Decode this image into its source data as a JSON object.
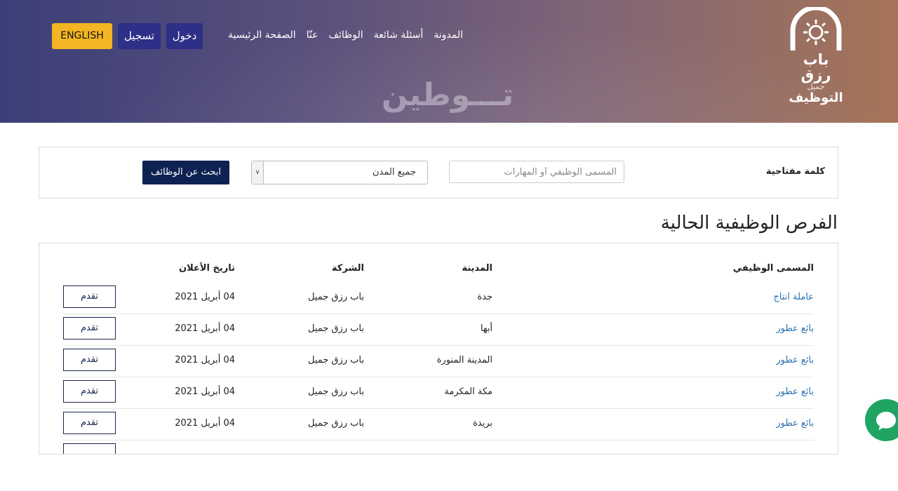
{
  "header": {
    "logo": {
      "line1": "باب رزق",
      "line2": "جميل",
      "line3": "التوظيف"
    },
    "nav": [
      "الصفحة الرئيسية",
      "عنّا",
      "الوظائف",
      "أسئلة شائعة",
      "المدونة"
    ],
    "login_label": "دخول",
    "register_label": "تسجيل",
    "english_label": "ENGLISH",
    "watermark": "تـــوطين",
    "colors": {
      "gradient_start": "#3c3f78",
      "gradient_end": "#a67458",
      "english_btn": "#f4b524",
      "auth_btn": "#2e2f86"
    }
  },
  "search": {
    "keyword_label": "كلمة مفتاحية",
    "keyword_placeholder": "المسمى الوظيفي أو المهارات",
    "city_value": "جميع المدن",
    "submit_label": "ابحث عن الوظائف",
    "submit_color": "#0e2252"
  },
  "section_title": "الفرص الوظيفية الحالية",
  "table": {
    "headers": {
      "title": "المسمى الوظيفي",
      "city": "المدينة",
      "company": "الشركة",
      "date": "تاريخ الأعلان"
    },
    "apply_label": "تقدم",
    "rows": [
      {
        "title": "عاملة انتاج",
        "city": "جدة",
        "company": "باب رزق جميل",
        "date": "04 أبريل 2021"
      },
      {
        "title": "بائع عطور",
        "city": "أبها",
        "company": "باب رزق جميل",
        "date": "04 أبريل 2021"
      },
      {
        "title": "بائع عطور",
        "city": "المدينة المنورة",
        "company": "باب رزق جميل",
        "date": "04 أبريل 2021"
      },
      {
        "title": "بائع عطور",
        "city": "مكة المكرمة",
        "company": "باب رزق جميل",
        "date": "04 أبريل 2021"
      },
      {
        "title": "بائع عطور",
        "city": "بريدة",
        "company": "باب رزق جميل",
        "date": "04 أبريل 2021"
      }
    ]
  },
  "chat": {
    "icon": "chat-icon",
    "color": "#1fa463"
  }
}
